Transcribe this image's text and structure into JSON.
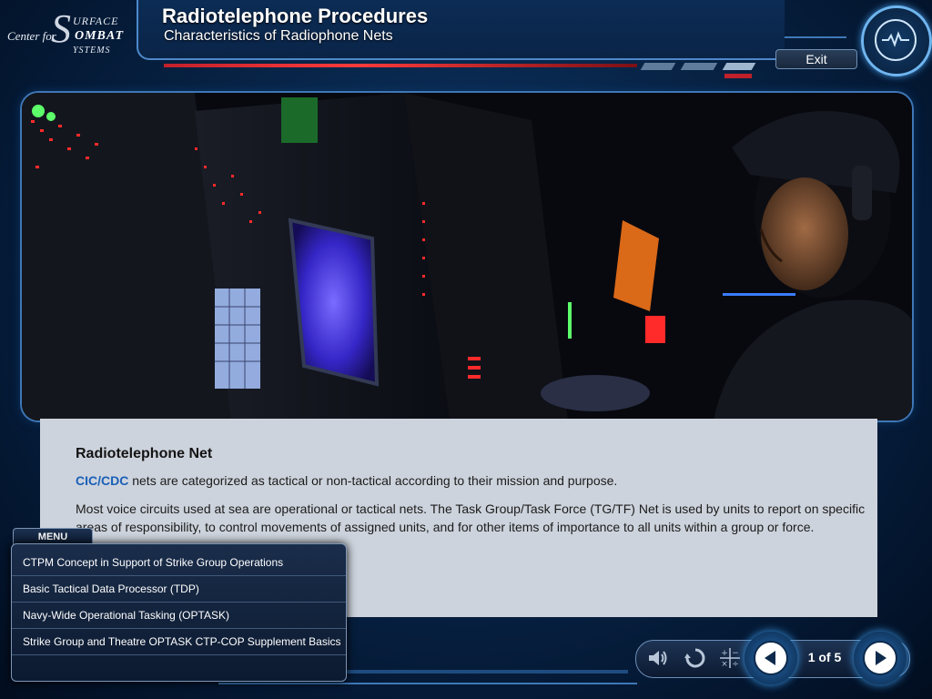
{
  "logo": {
    "line1": "Center for",
    "big_letter": "S",
    "line2": "URFACE",
    "line3": "OMBAT",
    "line4": "YSTEMS"
  },
  "header": {
    "title": "Radiotelephone Procedures",
    "subtitle": "Characteristics of Radiophone Nets",
    "exit_label": "Exit"
  },
  "content": {
    "heading": "Radiotelephone Net",
    "para1_highlight": "CIC/CDC",
    "para1_rest": " nets are categorized as tactical or non-tactical according to their mission and purpose.",
    "para2": "Most voice circuits used at sea are operational or tactical nets. The Task Group/Task Force (TG/TF) Net is used by units to report on specific areas of responsibility, to control movements of assigned units, and for other items of importance to all units within a group or force."
  },
  "menu": {
    "tab_label": "MENU",
    "items": [
      {
        "label": "CTPM Concept in Support of Strike Group Operations"
      },
      {
        "label": "Basic Tactical Data Processor (TDP)"
      },
      {
        "label": "Navy-Wide Operational Tasking (OPTASK)"
      },
      {
        "label": "Strike Group and Theatre OPTASK CTP-COP Supplement Basics"
      }
    ]
  },
  "navigation": {
    "page_indicator": "1 of 5",
    "icons": [
      "speaker-icon",
      "replay-icon",
      "calculator-icon",
      "previous-icon",
      "next-icon"
    ]
  },
  "colors": {
    "accent_blue": "#4d88c9",
    "highlight_link": "#1a5fb8",
    "red_bar": "#c0202a",
    "content_bg": "#cdd3dc"
  }
}
